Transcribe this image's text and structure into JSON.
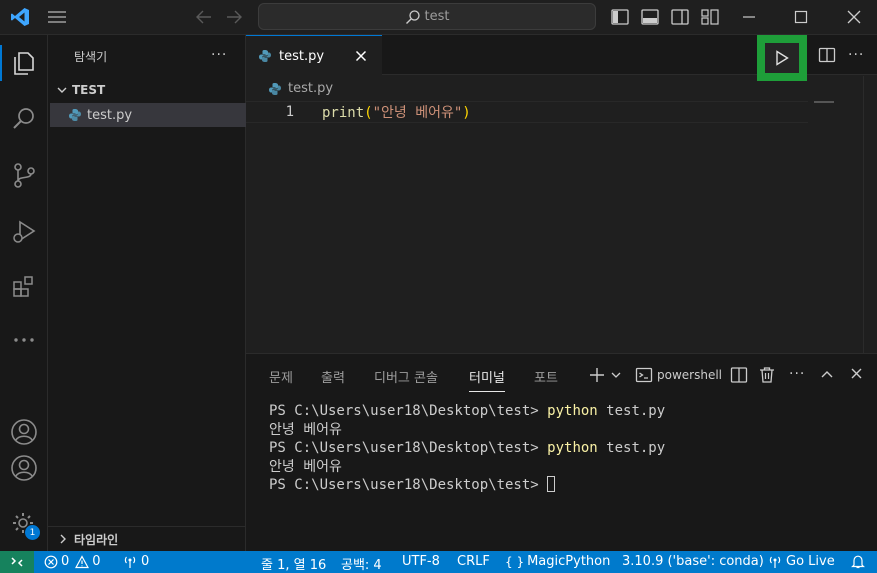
{
  "titlebar": {
    "search_text": "test"
  },
  "sidebar": {
    "title": "탐색기",
    "more": "···",
    "folder": "TEST",
    "file": "test.py",
    "timeline": "타임라인"
  },
  "editor": {
    "tab_label": "test.py",
    "breadcrumb": "test.py",
    "line_number": "1",
    "code_fn": "print",
    "code_open": "(",
    "code_string": "\"안녕 베어유\"",
    "code_close": ")",
    "more": "···"
  },
  "panel": {
    "tabs": [
      "문제",
      "출력",
      "디버그 콘솔",
      "터미널",
      "포트"
    ],
    "active_tab": "터미널",
    "terminal_name": "powershell",
    "more": "···",
    "terminal": {
      "prompt": "PS C:\\Users\\user18\\Desktop\\test> ",
      "cmd_python": "python",
      "cmd_arg": " test.py",
      "output": "안녕 베어유"
    }
  },
  "statusbar": {
    "errors": "0",
    "warnings": "0",
    "ports": "0",
    "position": "줄 1, 열 16",
    "indent": "공백: 4",
    "encoding": "UTF-8",
    "eol": "CRLF",
    "language": "MagicPython",
    "interpreter": "3.10.9 ('base': conda)",
    "golive": "Go Live"
  },
  "badges": {
    "settings_count": "1"
  },
  "colors": {
    "statusbar": "#007acc",
    "remote": "#16825d",
    "run_highlight": "#1e9e39",
    "accent": "#0078d4"
  }
}
